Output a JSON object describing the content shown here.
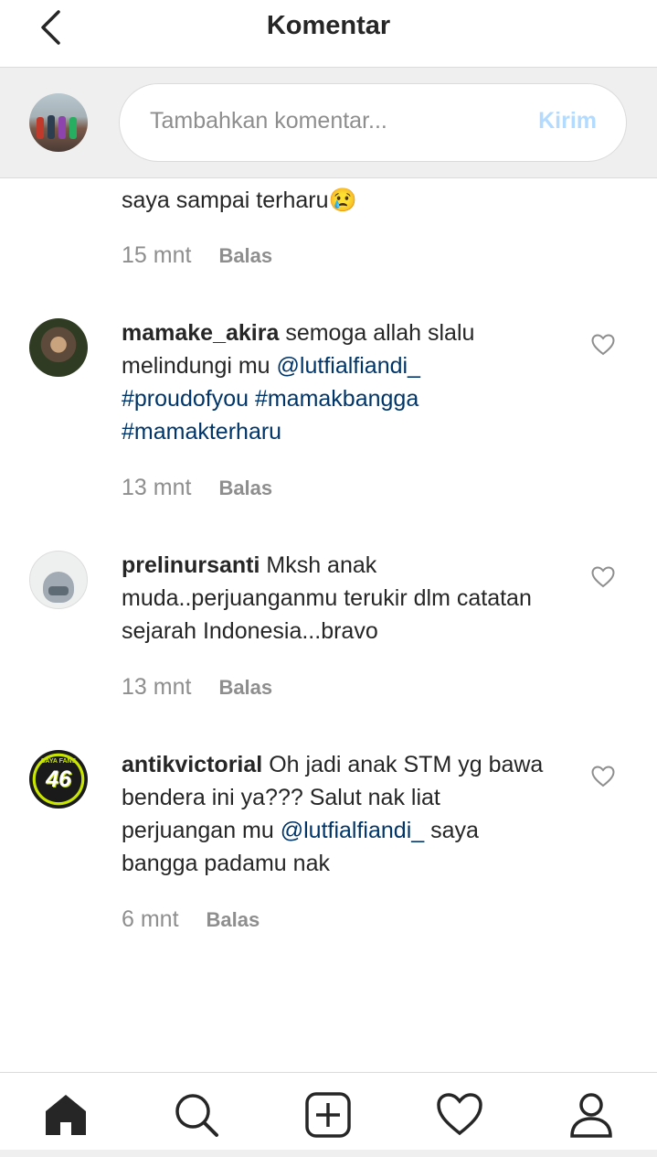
{
  "header": {
    "title": "Komentar",
    "back_icon": "back-arrow-icon"
  },
  "composer": {
    "placeholder": "Tambahkan komentar...",
    "send_label": "Kirim"
  },
  "comments": [
    {
      "text": "saya sampai terharu😢",
      "time": "15 mnt",
      "reply": "Balas"
    },
    {
      "username": "mamake_akira",
      "text_1": "semoga allah slalu melindungi mu",
      "mention": "@lutfialfiandi_",
      "hashtags": "#proudofyou #mamakbangga #mamakterharu",
      "time": "13 mnt",
      "reply": "Balas"
    },
    {
      "username": "prelinursanti",
      "text_1": "Mksh anak muda..perjuanganmu terukir dlm catatan sejarah Indonesia...bravo",
      "time": "13 mnt",
      "reply": "Balas"
    },
    {
      "username": "antikvictorial",
      "text_1": "Oh jadi anak STM yg bawa bendera ini ya??? Salut nak liat perjuangan mu",
      "mention": "@lutfialfiandi_",
      "text_2": "saya bangga padamu nak",
      "time": "6 mnt",
      "reply": "Balas",
      "avatar_text_top": "SAYA FANS",
      "avatar_text_num": "46"
    }
  ],
  "nav": {
    "items": [
      "home-icon",
      "search-icon",
      "add-post-icon",
      "activity-heart-icon",
      "profile-icon"
    ]
  },
  "colors": {
    "link": "#003569",
    "muted": "#8e8e8e",
    "send_disabled": "#b3dbff"
  }
}
